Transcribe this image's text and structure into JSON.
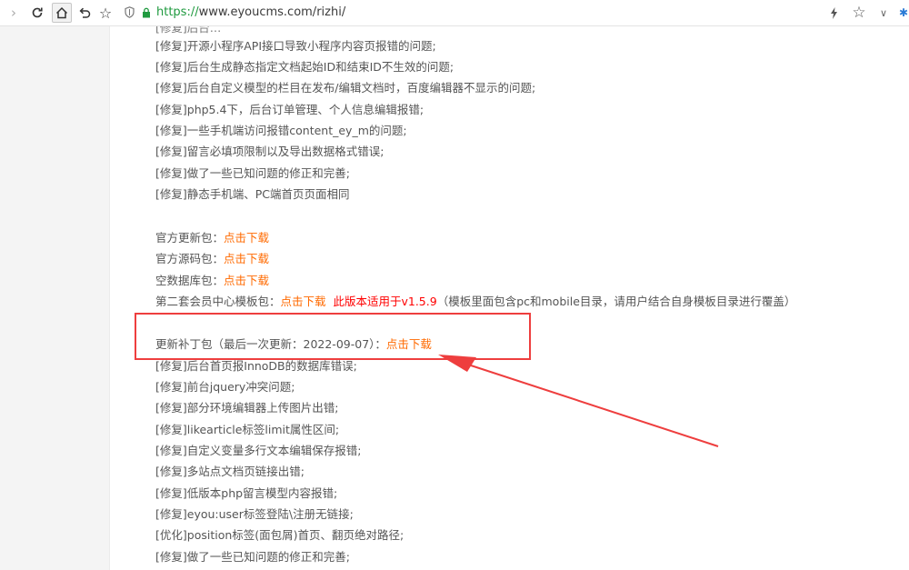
{
  "browser": {
    "url_scheme": "https://",
    "url_rest": "www.eyoucms.com/rizhi/",
    "icons": [
      "chevron-right-icon",
      "refresh-icon",
      "home-icon",
      "undo-icon",
      "star-icon",
      "shield-icon",
      "lock-icon",
      "lightning-icon",
      "bookmark-star-icon",
      "chevron-down-icon"
    ]
  },
  "content": {
    "fix_lines_top": [
      "[修复]开源小程序API接口导致小程序内容页报错的问题;",
      "[修复]后台生成静态指定文档起始ID和结束ID不生效的问题;",
      "[修复]后台自定义模型的栏目在发布/编辑文档时，百度编辑器不显示的问题;",
      "[修复]php5.4下，后台订单管理、个人信息编辑报错;",
      "[修复]一些手机端访问报错content_ey_m的问题;",
      "[修复]留言必填项限制以及导出数据格式错误;",
      "[修复]做了一些已知问题的修正和完善;",
      "[修复]静态手机端、PC端首页页面相同"
    ],
    "downloads": [
      {
        "label": "官方更新包：",
        "link": "点击下载"
      },
      {
        "label": "官方源码包：",
        "link": "点击下载"
      },
      {
        "label": "空数据库包：",
        "link": "点击下载"
      }
    ],
    "member_template": {
      "label": "第二套会员中心模板包：",
      "link": "点击下载",
      "note": "此版本适用于v1.5.9",
      "suffix": "（模板里面包含pc和mobile目录，请用户结合自身模板目录进行覆盖）"
    },
    "patch": {
      "label": "更新补丁包（最后一次更新：2022-09-07）：",
      "link": "点击下载"
    },
    "fix_lines_bottom": [
      "[修复]后台首页报InnoDB的数据库错误;",
      "[修复]前台jquery冲突问题;",
      "[修复]部分环境编辑器上传图片出错;",
      "[修复]likearticle标签limit属性区间;",
      "[修复]自定义变量多行文本编辑保存报错;",
      "[修复]多站点文档页链接出错;",
      "[修复]低版本php留言模型内容报错;",
      "[修复]eyou:user标签登陆\\注册无链接;",
      "[优化]position标签(面包屑)首页、翻页绝对路径;",
      "[修复]做了一些已知问题的修正和完善;"
    ]
  },
  "colors": {
    "link": "#ff6a00",
    "note_red": "#ff0000",
    "annotation": "#ee3e3e",
    "url_green": "#1f9a3f"
  }
}
